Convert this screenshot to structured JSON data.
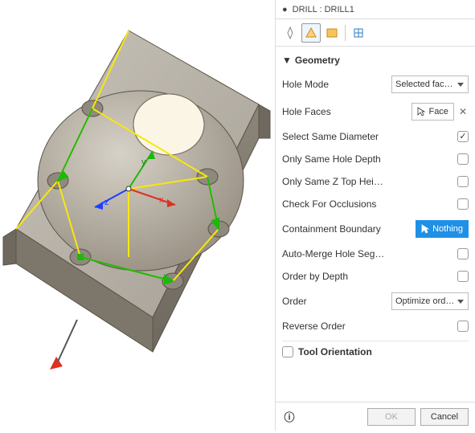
{
  "header": {
    "back": "●",
    "title": "DRILL : DRILL1"
  },
  "tabs": [
    "tool",
    "geometry",
    "heights",
    "cycle"
  ],
  "section": {
    "geometry_title": "Geometry",
    "tool_orientation_title": "Tool Orientation"
  },
  "props": {
    "hole_mode": {
      "label": "Hole Mode",
      "value": "Selected fac…"
    },
    "hole_faces": {
      "label": "Hole Faces",
      "chip": "Face"
    },
    "select_same_diameter": {
      "label": "Select Same Diameter",
      "checked": true
    },
    "only_same_hole_depth": {
      "label": "Only Same Hole Depth",
      "checked": false
    },
    "only_same_z_top": {
      "label": "Only Same Z Top Height",
      "checked": false
    },
    "check_occlusions": {
      "label": "Check For Occlusions",
      "checked": false
    },
    "containment_boundary": {
      "label": "Containment Boundary",
      "chip": "Nothing"
    },
    "auto_merge": {
      "label": "Auto-Merge Hole Segmen…",
      "checked": false
    },
    "order_by_depth": {
      "label": "Order by Depth",
      "checked": false
    },
    "order": {
      "label": "Order",
      "value": "Optimize ord…"
    },
    "reverse_order": {
      "label": "Reverse Order",
      "checked": false
    },
    "tool_orientation_expand": {
      "checked": false
    }
  },
  "footer": {
    "ok": "OK",
    "cancel": "Cancel"
  },
  "viewport": {
    "axes": {
      "x": "x",
      "y": "y",
      "z": "z"
    }
  }
}
